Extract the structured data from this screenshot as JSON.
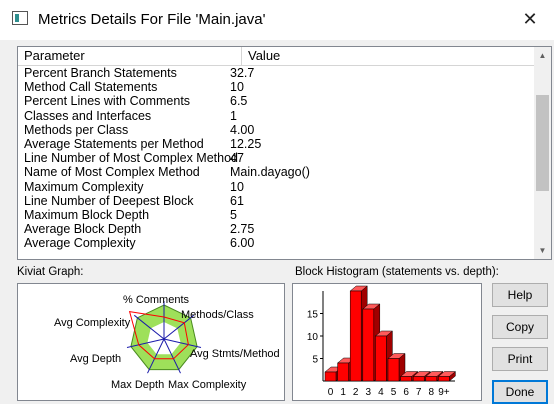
{
  "window": {
    "title": "Metrics Details For File 'Main.java'",
    "close_glyph": "✕"
  },
  "table": {
    "header": {
      "parameter": "Parameter",
      "value": "Value"
    },
    "rows": [
      {
        "p": "Percent Branch Statements",
        "v": "32.7"
      },
      {
        "p": "Method Call Statements",
        "v": "10"
      },
      {
        "p": "Percent Lines with Comments",
        "v": "6.5"
      },
      {
        "p": "Classes and Interfaces",
        "v": "1"
      },
      {
        "p": "Methods per Class",
        "v": "4.00"
      },
      {
        "p": "Average Statements per Method",
        "v": "12.25"
      },
      {
        "p": "Line Number of Most Complex Method",
        "v": "47"
      },
      {
        "p": "Name of Most Complex Method",
        "v": "Main.dayago()"
      },
      {
        "p": "Maximum Complexity",
        "v": "10"
      },
      {
        "p": "Line Number of Deepest Block",
        "v": "61"
      },
      {
        "p": "Maximum Block Depth",
        "v": "5"
      },
      {
        "p": "Average Block Depth",
        "v": "2.75"
      },
      {
        "p": "Average Complexity",
        "v": "6.00"
      }
    ]
  },
  "kiviat": {
    "caption": "Kiviat Graph:",
    "axes": [
      "% Comments",
      "Methods/Class",
      "Avg Stmts/Method",
      "Max Complexity",
      "Max Depth",
      "Avg Depth",
      "Avg Complexity"
    ],
    "colors": {
      "band": "#9ee05a",
      "outline": "#ff0000",
      "spoke": "#1a1aaa"
    }
  },
  "histogram": {
    "caption": "Block Histogram (statements vs. depth):",
    "bar_color": "#ff0000"
  },
  "chart_data": {
    "type": "bar",
    "title": "Block Histogram (statements vs. depth):",
    "categories": [
      "0",
      "1",
      "2",
      "3",
      "4",
      "5",
      "6",
      "7",
      "8",
      "9+"
    ],
    "values": [
      2,
      4,
      20,
      16,
      10,
      5,
      1,
      1,
      1,
      1
    ],
    "yticks": [
      "5",
      "10",
      "15"
    ],
    "ylim": [
      0,
      20
    ],
    "grid": false
  },
  "buttons": {
    "help": "Help",
    "copy": "Copy",
    "print": "Print",
    "done": "Done"
  }
}
